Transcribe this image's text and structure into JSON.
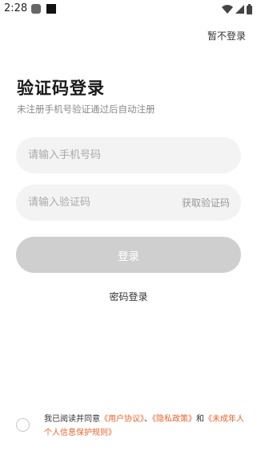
{
  "status_bar": {
    "time": "2:28",
    "icons": [
      "app-notification-icon",
      "app-notification-icon",
      "wifi-icon",
      "signal-icon",
      "battery-icon"
    ]
  },
  "header": {
    "skip_label": "暂不登录"
  },
  "main": {
    "title": "验证码登录",
    "subtitle": "未注册手机号验证通过后自动注册",
    "phone_placeholder": "请输入手机号码",
    "code_placeholder": "请输入验证码",
    "get_code_label": "获取验证码",
    "login_label": "登录",
    "password_login_label": "密码登录"
  },
  "agreement": {
    "prefix": "我已阅读并同意",
    "user_agreement": "《用户协议》",
    "separator": "、",
    "privacy_policy": "《隐私政策》",
    "and": "和",
    "minor_rules": "《未成年人个人信息保护规则》"
  },
  "colors": {
    "link": "#e8632e",
    "button_disabled": "#cfcfcf",
    "field_bg": "#f3f3f3"
  }
}
